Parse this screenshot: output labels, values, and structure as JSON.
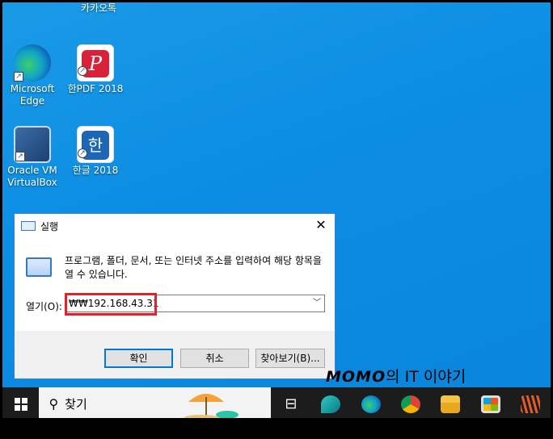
{
  "desktop": {
    "icons": [
      {
        "label": "카카오톡"
      },
      {
        "label": "Microsoft Edge"
      },
      {
        "label": "한PDF 2018"
      },
      {
        "label": "Oracle VM VirtualBox"
      },
      {
        "label": "한글 2018"
      }
    ]
  },
  "run_dialog": {
    "title": "실행",
    "description": "프로그램, 폴더, 문서, 또는 인터넷 주소를 입력하여 해당 항목을 열 수 있습니다.",
    "open_label": "열기(O):",
    "open_value": "₩₩192.168.43.31",
    "ok_label": "확인",
    "cancel_label": "취소",
    "browse_label": "찾아보기(B)...",
    "close_glyph": "✕"
  },
  "watermark": {
    "brand": "MOMO",
    "rest": "의 IT 이야기"
  },
  "taskbar": {
    "search_placeholder": "찾기",
    "apps": [
      "task-view",
      "app-bird",
      "edge",
      "chrome",
      "file-explorer",
      "store",
      "app-stripes"
    ]
  },
  "colors": {
    "highlight": "#e5202a",
    "desktop": "#0b8de3",
    "taskbar": "#1c1c1c"
  }
}
